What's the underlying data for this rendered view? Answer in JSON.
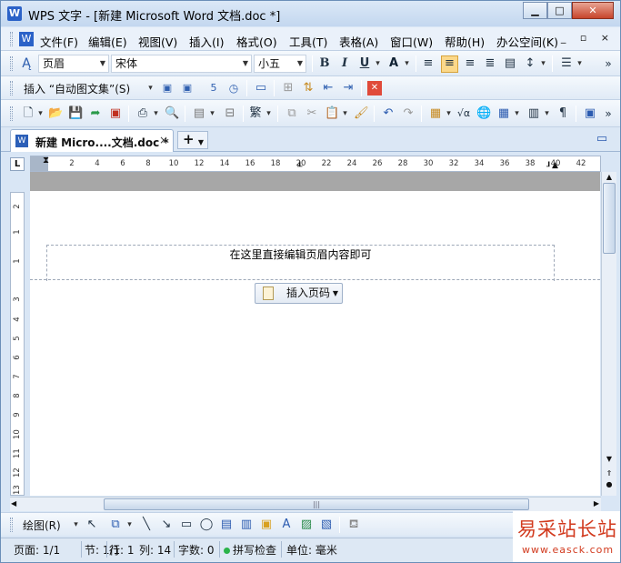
{
  "window": {
    "title": "WPS 文字 - [新建 Microsoft Word 文档.doc *]",
    "app_icon_letter": "W",
    "controls": {
      "minimize": "▁",
      "maximize": "□",
      "close": "✕"
    }
  },
  "menubar": {
    "items": [
      "文件(F)",
      "编辑(E)",
      "视图(V)",
      "插入(I)",
      "格式(O)",
      "工具(T)",
      "表格(A)",
      "窗口(W)",
      "帮助(H)",
      "办公空间(K)"
    ],
    "doc_controls": "_ ▫ ×"
  },
  "format_toolbar": {
    "style_value": "页眉",
    "font_value": "宋体",
    "size_value": "小五",
    "bold": "B",
    "italic": "I",
    "underline": "U",
    "font_color": "A",
    "more": "»"
  },
  "autotext_toolbar": {
    "label": "插入 “自动图文集”(S)"
  },
  "tabs": {
    "active_label": "新建 Micro....文档.doc *",
    "close": "×",
    "add": "+"
  },
  "ruler": {
    "corner": "L",
    "h_numbers": [
      "2",
      "4",
      "6",
      "8",
      "10",
      "12",
      "14",
      "16",
      "18",
      "20",
      "22",
      "24",
      "26",
      "28",
      "30",
      "32",
      "34",
      "36",
      "38",
      "40",
      "42"
    ],
    "v_numbers": [
      "2",
      "1",
      "1",
      "3",
      "4",
      "5",
      "6",
      "7",
      "8",
      "9",
      "10",
      "11",
      "12",
      "13"
    ]
  },
  "document": {
    "header_placeholder": "在这里直接编辑页眉内容即可",
    "insert_page_number_label": "插入页码"
  },
  "drawing_toolbar": {
    "label": "绘图(R)"
  },
  "statusbar": {
    "page": "页面: 1/1",
    "section": "节: 1/1",
    "row": "行: 1",
    "col": "列: 14",
    "word_count": "字数: 0",
    "spell_check": "拼写检查",
    "unit": "单位: 毫米"
  },
  "watermark": {
    "cn": "易采站长站",
    "url": "www.easck.com"
  },
  "colors": {
    "accent": "#2b62c8",
    "active_toggle": "#fbd88a",
    "close_button": "#c7452c",
    "watermark": "#d23a1e"
  }
}
